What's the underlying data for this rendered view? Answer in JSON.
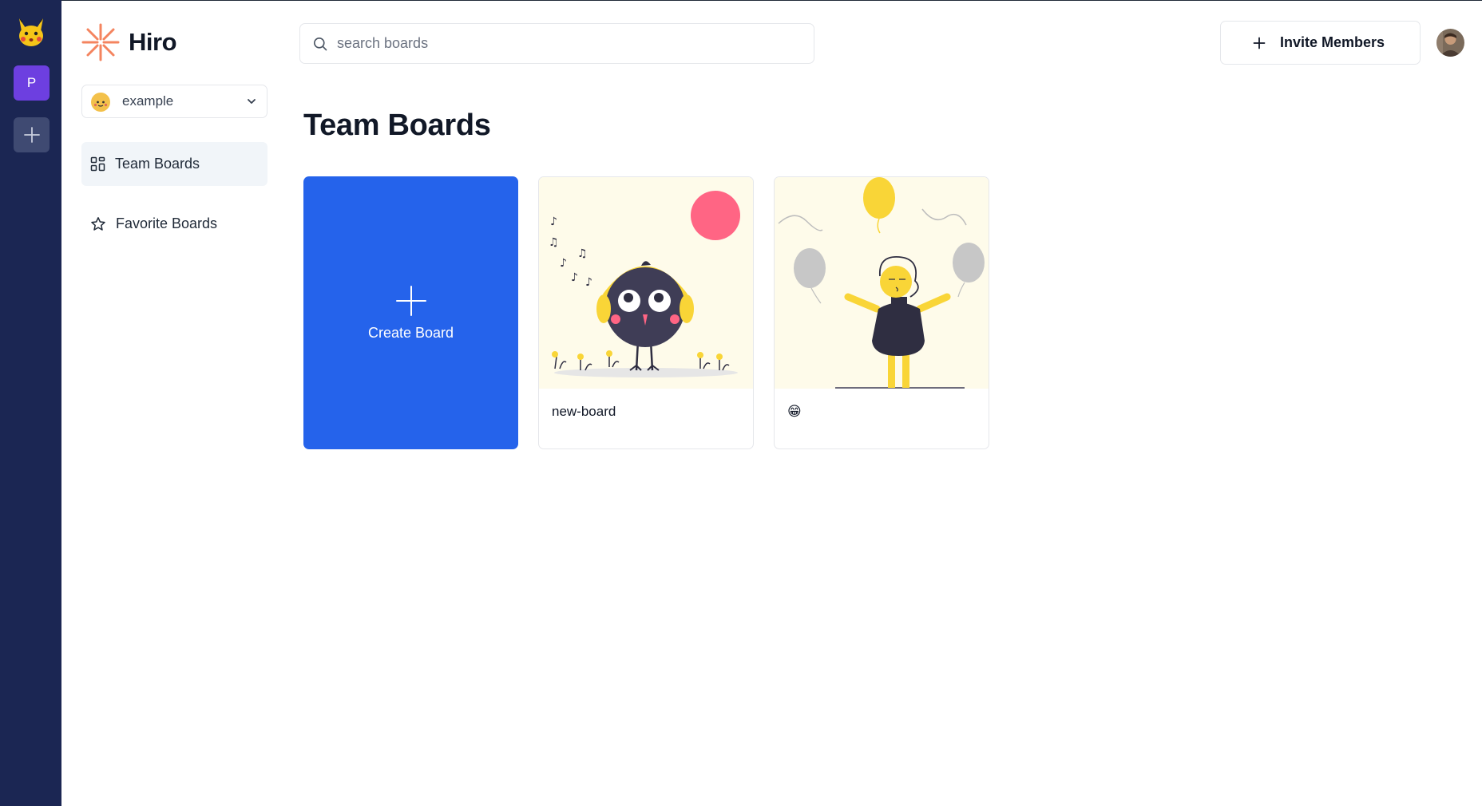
{
  "rail": {
    "workspace_initial": "P"
  },
  "brand": {
    "name": "Hiro",
    "accent": "#f4845f"
  },
  "team_selector": {
    "selected": "example"
  },
  "sidebar": {
    "items": [
      {
        "label": "Team Boards",
        "icon": "grid-icon",
        "active": true
      },
      {
        "label": "Favorite Boards",
        "icon": "star-icon",
        "active": false
      }
    ]
  },
  "search": {
    "placeholder": "search boards",
    "value": ""
  },
  "header": {
    "invite_label": "Invite Members"
  },
  "main": {
    "title": "Team Boards",
    "create_label": "Create Board",
    "boards": [
      {
        "name": "new-board",
        "illustration": "bird-headphones"
      },
      {
        "name": "😁",
        "illustration": "person-balloons"
      }
    ]
  },
  "colors": {
    "rail_bg": "#1b2653",
    "workspace": "#6d3fe0",
    "primary": "#2563eb",
    "thumb_bg": "#fefbea"
  }
}
